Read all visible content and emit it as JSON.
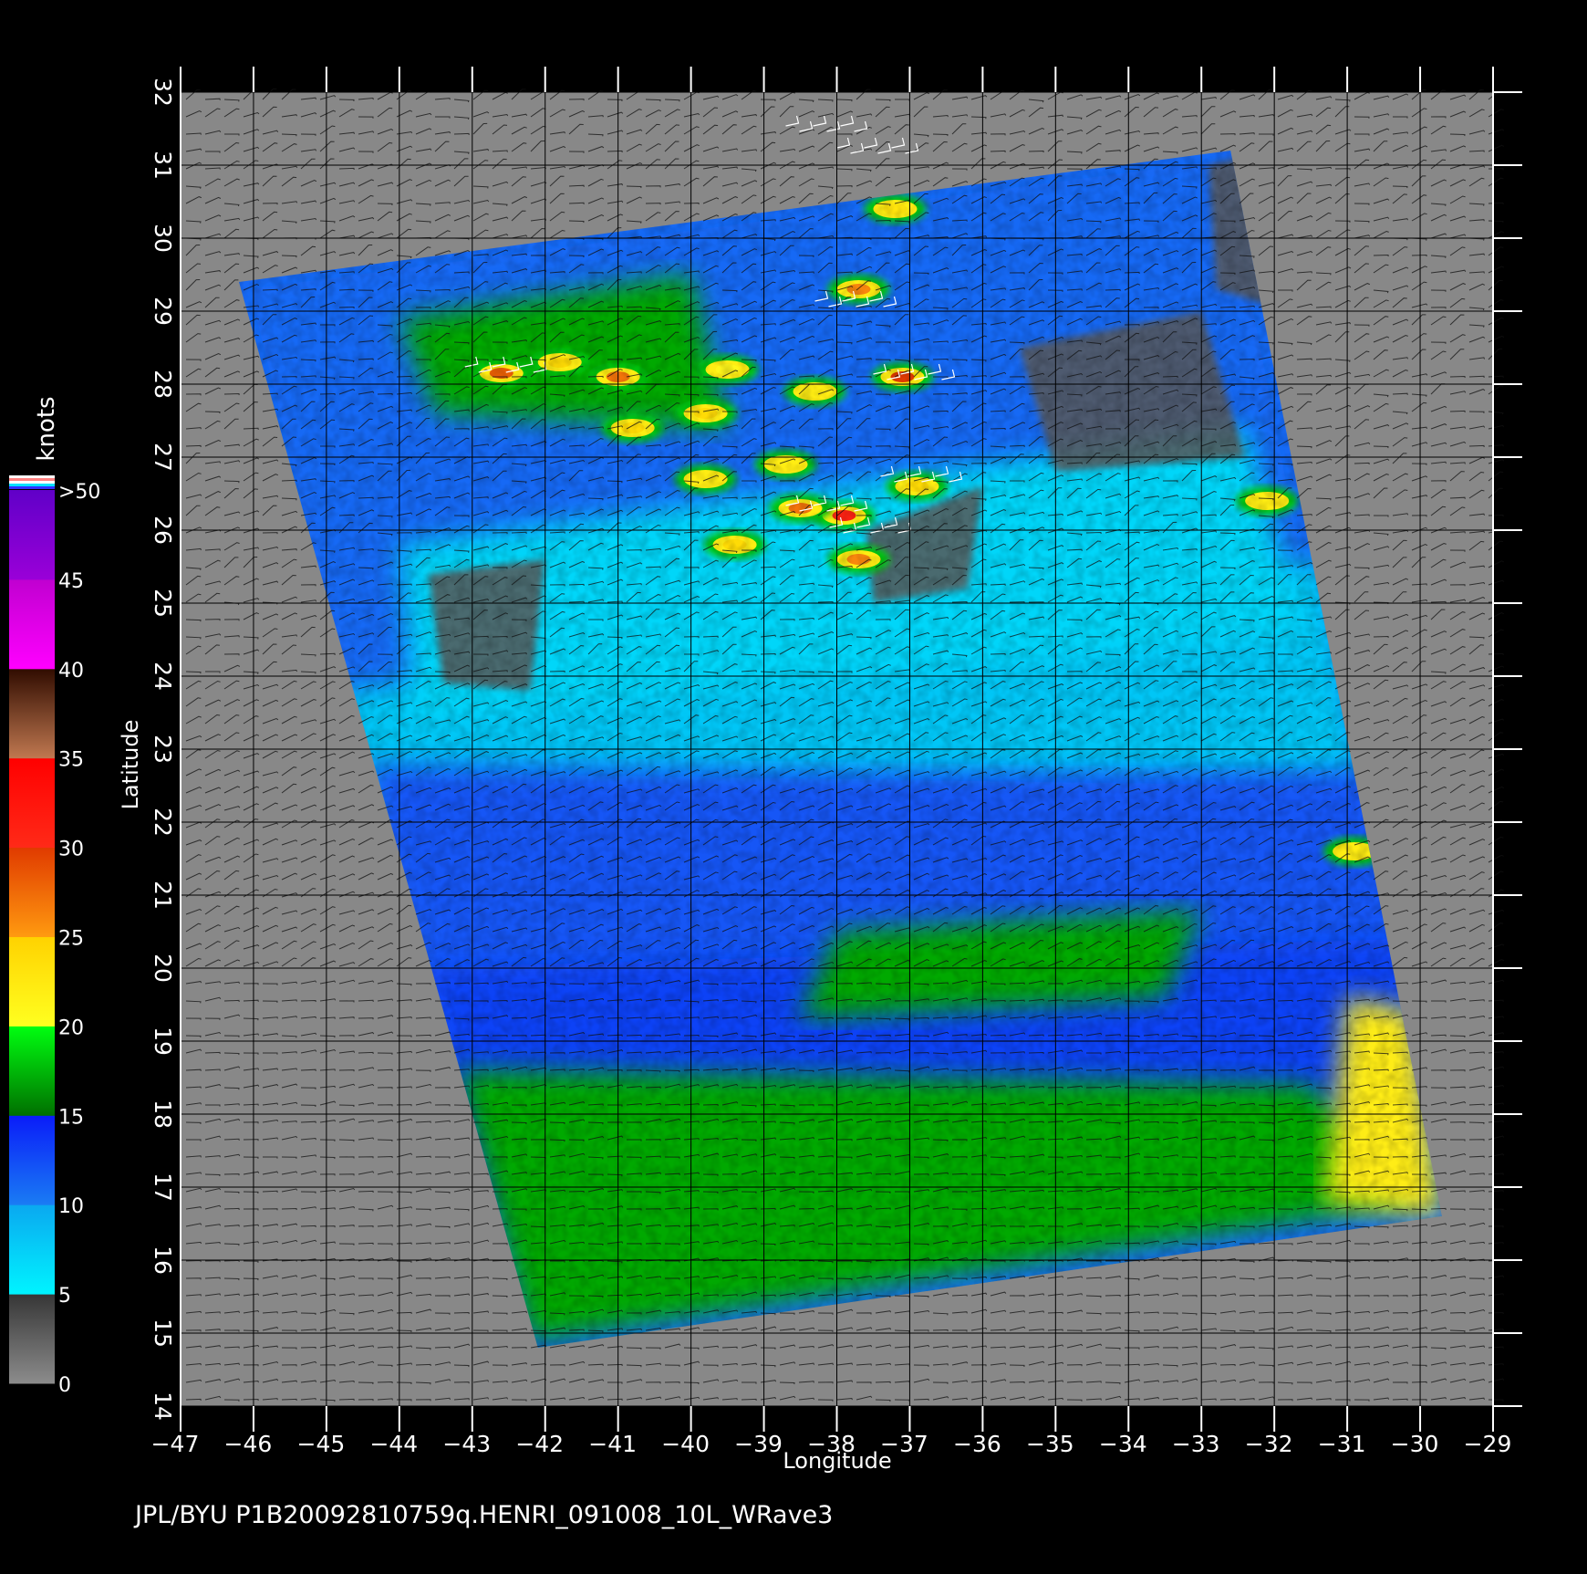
{
  "footer": "JPL/BYU  P1B20092810759q.HENRI_091008_10L_WRave3",
  "colorbar": {
    "unit": "knots",
    "labels": [
      "0",
      "5",
      "10",
      "15",
      "20",
      "25",
      "30",
      "35",
      "40",
      "45",
      ">50"
    ],
    "stops": [
      {
        "from": 0,
        "to": 5,
        "top": "#363636",
        "bottom": "#8c8c8c"
      },
      {
        "from": 5,
        "to": 10,
        "top": "#0aa8f0",
        "bottom": "#00f4ff"
      },
      {
        "from": 10,
        "to": 15,
        "top": "#0a1cf8",
        "bottom": "#1a7cf4"
      },
      {
        "from": 15,
        "to": 20,
        "top": "#00ff10",
        "bottom": "#007000"
      },
      {
        "from": 20,
        "to": 25,
        "top": "#ffd200",
        "bottom": "#ffff20"
      },
      {
        "from": 25,
        "to": 30,
        "top": "#e03a00",
        "bottom": "#ff9a10"
      },
      {
        "from": 30,
        "to": 35,
        "top": "#ff0000",
        "bottom": "#ff2a18"
      },
      {
        "from": 35,
        "to": 40,
        "top": "#300c00",
        "bottom": "#c07850"
      },
      {
        "from": 40,
        "to": 45,
        "top": "#c000d0",
        "bottom": "#ff00ff"
      },
      {
        "from": 45,
        "to": 50,
        "top": "#6000c8",
        "bottom": "#9a00d8"
      }
    ],
    "top_stripes": [
      "#ffffff",
      "#ff8080",
      "#ffffff",
      "#00e0ff",
      "#3030ff"
    ]
  },
  "chart_data": {
    "type": "heatmap",
    "title": "",
    "xlabel": "Longitude",
    "ylabel": "Latitude",
    "xlim": [
      -47,
      -29
    ],
    "ylim": [
      14,
      32
    ],
    "x_ticks": [
      "-47",
      "-46",
      "-45",
      "-44",
      "-43",
      "-42",
      "-41",
      "-40",
      "-39",
      "-38",
      "-37",
      "-36",
      "-35",
      "-34",
      "-33",
      "-32",
      "-31",
      "-30",
      "-29"
    ],
    "y_ticks": [
      "14",
      "15",
      "16",
      "17",
      "18",
      "19",
      "20",
      "21",
      "22",
      "23",
      "24",
      "25",
      "26",
      "27",
      "28",
      "29",
      "30",
      "31",
      "32"
    ],
    "grid": true,
    "value_unit": "knots",
    "background_color": "#888888",
    "swath_corners": [
      {
        "lon": -46.2,
        "lat": 29.4
      },
      {
        "lon": -32.6,
        "lat": 31.2
      },
      {
        "lon": -29.7,
        "lat": 16.6
      },
      {
        "lon": -42.1,
        "lat": 14.8
      }
    ],
    "wind_regions": [
      {
        "speed": 11,
        "polygon": [
          [
            -46.2,
            29.4
          ],
          [
            -32.6,
            31.2
          ],
          [
            -31.4,
            25.0
          ],
          [
            -44.7,
            23.4
          ]
        ]
      },
      {
        "speed": 8,
        "polygon": [
          [
            -44.9,
            23.8
          ],
          [
            -31.3,
            25.6
          ],
          [
            -30.8,
            22.7
          ],
          [
            -44.5,
            22.2
          ]
        ]
      },
      {
        "speed": 7,
        "polygon": [
          [
            -44.0,
            25.8
          ],
          [
            -32.4,
            27.4
          ],
          [
            -31.6,
            24.6
          ],
          [
            -43.8,
            23.4
          ]
        ]
      },
      {
        "speed": 12,
        "polygon": [
          [
            -44.5,
            22.8
          ],
          [
            -30.6,
            22.6
          ],
          [
            -30.0,
            20.1
          ],
          [
            -43.6,
            19.6
          ]
        ]
      },
      {
        "speed": 13,
        "polygon": [
          [
            -43.7,
            20.0
          ],
          [
            -30.2,
            20.4
          ],
          [
            -29.8,
            17.5
          ],
          [
            -42.8,
            16.4
          ]
        ]
      },
      {
        "speed": 17,
        "polygon": [
          [
            -43.2,
            18.6
          ],
          [
            -31.5,
            18.4
          ],
          [
            -30.0,
            16.8
          ],
          [
            -42.2,
            14.9
          ]
        ]
      },
      {
        "speed": 17,
        "polygon": [
          [
            -38.0,
            20.5
          ],
          [
            -33.0,
            20.8
          ],
          [
            -33.5,
            19.6
          ],
          [
            -38.5,
            19.3
          ]
        ]
      },
      {
        "speed": 22,
        "polygon": [
          [
            -31.0,
            19.6
          ],
          [
            -30.1,
            19.4
          ],
          [
            -29.7,
            16.6
          ],
          [
            -31.3,
            16.8
          ]
        ]
      },
      {
        "speed": 17,
        "polygon": [
          [
            -44.0,
            28.9
          ],
          [
            -40.0,
            29.5
          ],
          [
            -39.5,
            27.4
          ],
          [
            -43.5,
            27.6
          ]
        ]
      }
    ],
    "low_wind_patches": [
      {
        "speed": 3,
        "polygon": [
          [
            -32.9,
            31.0
          ],
          [
            -32.0,
            31.2
          ],
          [
            -31.8,
            29.0
          ],
          [
            -32.8,
            29.3
          ]
        ]
      },
      {
        "speed": 3,
        "polygon": [
          [
            -35.5,
            28.5
          ],
          [
            -33.0,
            29.0
          ],
          [
            -32.4,
            27.0
          ],
          [
            -35.0,
            26.8
          ]
        ]
      },
      {
        "speed": 3,
        "polygon": [
          [
            -43.6,
            25.4
          ],
          [
            -42.0,
            25.6
          ],
          [
            -42.2,
            23.8
          ],
          [
            -43.4,
            23.9
          ]
        ]
      },
      {
        "speed": 3,
        "polygon": [
          [
            -37.6,
            26.0
          ],
          [
            -36.0,
            26.6
          ],
          [
            -36.2,
            25.2
          ],
          [
            -37.5,
            25.0
          ]
        ]
      }
    ],
    "high_wind_cells": [
      {
        "lon": -42.6,
        "lat": 28.15,
        "speed": 28
      },
      {
        "lon": -41.0,
        "lat": 28.1,
        "speed": 27
      },
      {
        "lon": -41.8,
        "lat": 28.3,
        "speed": 24
      },
      {
        "lon": -39.8,
        "lat": 27.6,
        "speed": 24
      },
      {
        "lon": -40.8,
        "lat": 27.4,
        "speed": 24
      },
      {
        "lon": -37.1,
        "lat": 28.1,
        "speed": 30
      },
      {
        "lon": -37.7,
        "lat": 29.3,
        "speed": 26
      },
      {
        "lon": -37.2,
        "lat": 30.4,
        "speed": 23
      },
      {
        "lon": -38.3,
        "lat": 27.9,
        "speed": 22
      },
      {
        "lon": -37.9,
        "lat": 26.2,
        "speed": 31
      },
      {
        "lon": -38.5,
        "lat": 26.3,
        "speed": 27
      },
      {
        "lon": -37.7,
        "lat": 25.6,
        "speed": 26
      },
      {
        "lon": -36.9,
        "lat": 26.6,
        "speed": 24
      },
      {
        "lon": -39.4,
        "lat": 25.8,
        "speed": 24
      },
      {
        "lon": -38.7,
        "lat": 26.9,
        "speed": 22
      },
      {
        "lon": -39.8,
        "lat": 26.7,
        "speed": 22
      },
      {
        "lon": -32.1,
        "lat": 26.4,
        "speed": 22
      },
      {
        "lon": -30.9,
        "lat": 21.6,
        "speed": 22
      },
      {
        "lon": -39.5,
        "lat": 28.2,
        "speed": 21
      }
    ],
    "wind_barbs": "sparse barb field drawn over entire map; white barbs mark rain-flagged cells near -38, 26 to 30"
  }
}
